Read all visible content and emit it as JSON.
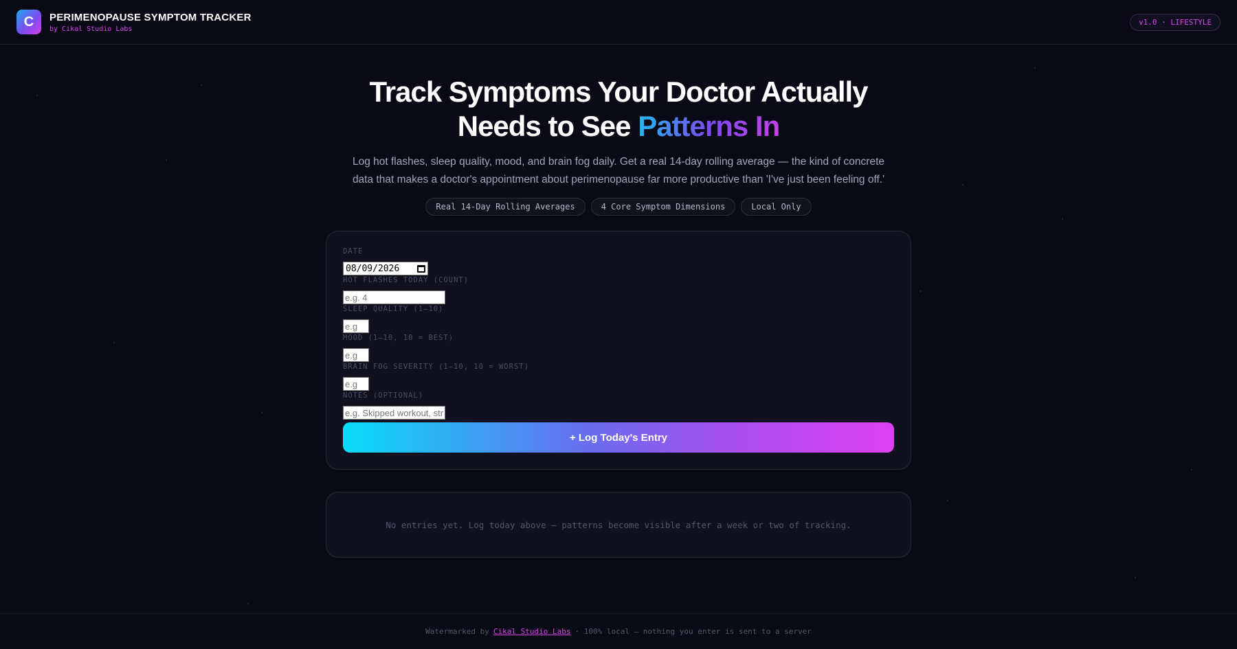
{
  "header": {
    "logo_letter": "C",
    "title": "PERIMENOPAUSE SYMPTOM TRACKER",
    "subtitle": "by Cikal Studio Labs",
    "version_badge": "v1.0 · LIFESTYLE"
  },
  "hero": {
    "title_line1": "Track Symptoms Your Doctor Actually",
    "title_line2_plain": "Needs to See ",
    "title_line2_accent": "Patterns In",
    "description": "Log hot flashes, sleep quality, mood, and brain fog daily. Get a real 14-day rolling average — the kind of concrete data that makes a doctor's appointment about perimenopause far more productive than 'I've just been feeling off.'",
    "pills": [
      "Real 14-Day Rolling Averages",
      "4 Core Symptom Dimensions",
      "Local Only"
    ]
  },
  "form": {
    "date_label": "DATE",
    "date_value": "08/09/2026",
    "hot_flashes_label": "HOT FLASHES TODAY (COUNT)",
    "hot_flashes_placeholder": "e.g. 4",
    "sleep_label": "SLEEP QUALITY (1–10)",
    "sleep_placeholder": "e.g",
    "mood_label": "MOOD (1–10, 10 = BEST)",
    "mood_placeholder": "e.g",
    "brain_fog_label": "BRAIN FOG SEVERITY (1–10, 10 = WORST)",
    "brain_fog_placeholder": "e.g",
    "notes_label": "NOTES (OPTIONAL)",
    "notes_placeholder": "e.g. Skipped workout, stressful day",
    "submit_label": "+ Log Today's Entry"
  },
  "entries": {
    "empty_message": "No entries yet. Log today above — patterns become visible after a week or two of tracking."
  },
  "footer": {
    "prefix": "Watermarked by",
    "link": "Cikal Studio Labs",
    "suffix": "· 100% local — nothing you enter is sent to a server"
  },
  "colors": {
    "background": "#0a0a16",
    "accent_magenta": "#d946ef",
    "accent_cyan": "#08dcf8",
    "card_bg": "#10101e"
  }
}
